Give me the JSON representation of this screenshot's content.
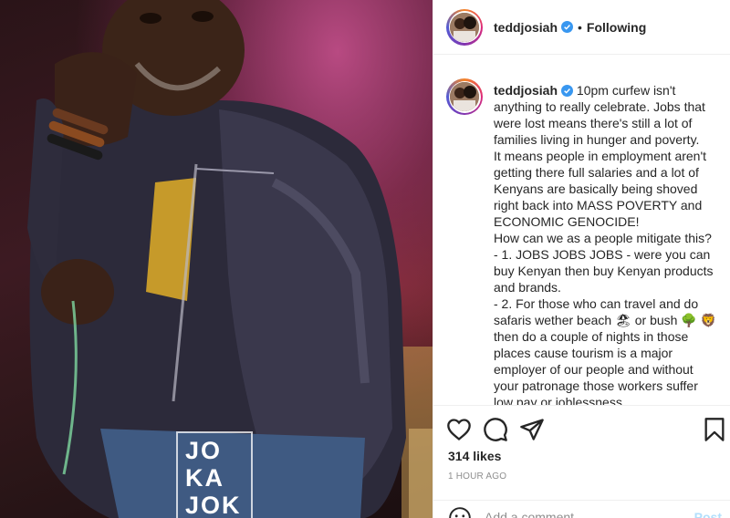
{
  "post": {
    "username": "teddjosiah",
    "follow_status": "Following",
    "separator": "•",
    "verified_icon": "verified-badge-icon",
    "caption_lines": [
      "10pm curfew isn't",
      "anything to really celebrate. Jobs that",
      "were lost means there's still a lot of",
      "families living in hunger and poverty.",
      "It means people in employment aren't",
      "getting there full salaries and a lot of",
      "Kenyans are basically being shoved",
      "right back into MASS POVERTY and",
      "ECONOMIC GENOCIDE!",
      "How can we as a people mitigate this?",
      "- 1. JOBS JOBS JOBS - were you can",
      "buy Kenyan then buy Kenyan products",
      "and brands.",
      "- 2. For those who can travel and do",
      "safaris wether beach 🏖 or bush 🌳 🦁",
      "then do a couple of nights in those",
      "places cause tourism is a major",
      "employer of our people and without",
      "your patronage those workers suffer",
      "low pay or joblessness."
    ],
    "likes": "314 likes",
    "time": "1 HOUR AGO"
  },
  "comment": {
    "placeholder": "Add a comment…",
    "post_label": "Post"
  },
  "photo": {
    "watermark_lines": [
      "JO",
      "KA",
      "JOK"
    ]
  },
  "colors": {
    "verified": "#3897f0",
    "link_disabled": "#b2dffc",
    "meta": "#8e8e8e",
    "border": "#efefef"
  },
  "icons": [
    "heart-icon",
    "comment-icon",
    "share-icon",
    "bookmark-icon",
    "emoji-icon"
  ]
}
